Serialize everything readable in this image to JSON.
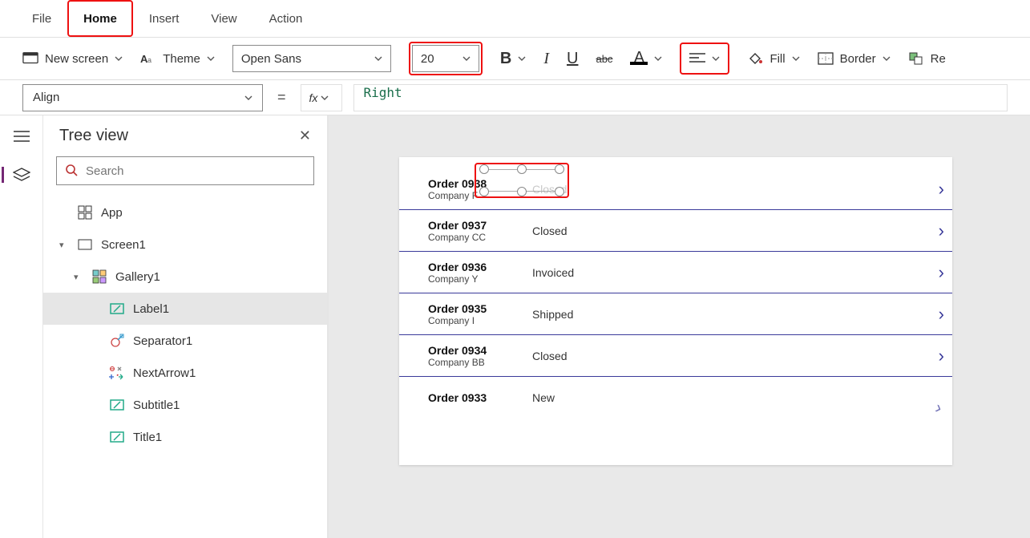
{
  "menu": {
    "tabs": [
      "File",
      "Home",
      "Insert",
      "View",
      "Action"
    ],
    "active": "Home"
  },
  "toolbar": {
    "new_screen": "New screen",
    "theme": "Theme",
    "font_name": "Open Sans",
    "font_size": "20",
    "bold": "B",
    "italic": "I",
    "underline": "U",
    "strike": "abc",
    "font_color": "A",
    "fill": "Fill",
    "border": "Border",
    "reorder": "Re"
  },
  "formula": {
    "property": "Align",
    "fx": "fx",
    "value": "Right"
  },
  "treeview": {
    "title": "Tree view",
    "search_placeholder": "Search",
    "nodes": {
      "app": "App",
      "screen": "Screen1",
      "gallery": "Gallery1",
      "label": "Label1",
      "separator": "Separator1",
      "nextarrow": "NextArrow1",
      "subtitle": "Subtitle1",
      "title": "Title1"
    }
  },
  "gallery": {
    "rows": [
      {
        "order": "Order 0938",
        "company": "Company F",
        "status": "Closed"
      },
      {
        "order": "Order 0937",
        "company": "Company CC",
        "status": "Closed"
      },
      {
        "order": "Order 0936",
        "company": "Company Y",
        "status": "Invoiced"
      },
      {
        "order": "Order 0935",
        "company": "Company I",
        "status": "Shipped"
      },
      {
        "order": "Order 0934",
        "company": "Company BB",
        "status": "Closed"
      },
      {
        "order": "Order 0933",
        "company": "",
        "status": "New"
      }
    ]
  }
}
